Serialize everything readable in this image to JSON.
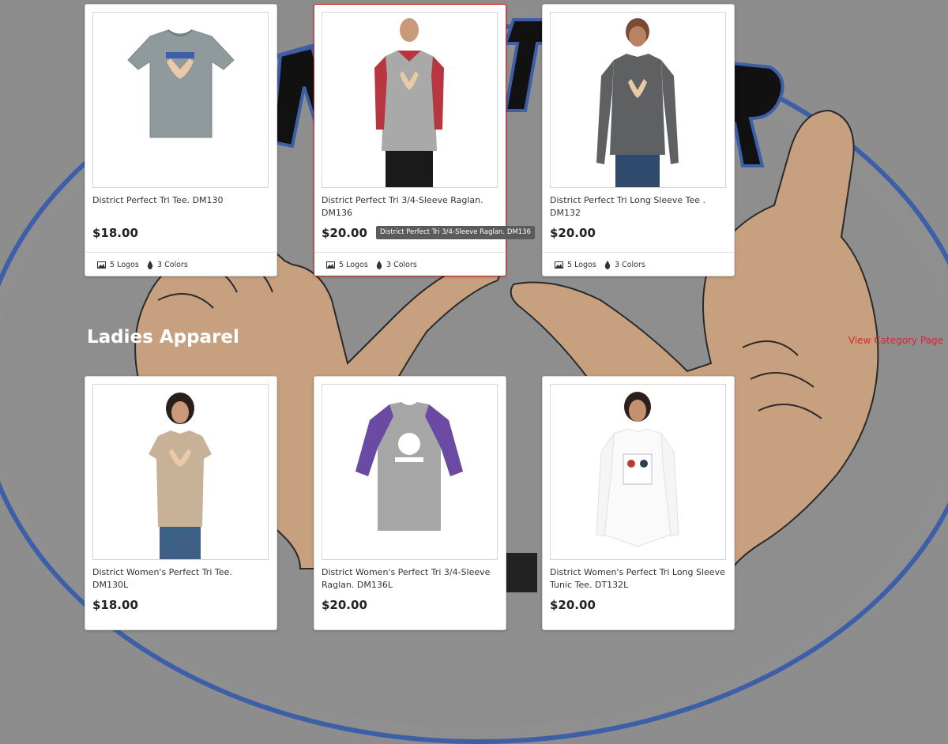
{
  "mens": {
    "products": [
      {
        "title": "District Perfect Tri Tee. DM130",
        "price": "$18.00",
        "logos": "5 Logos",
        "colors": "3 Colors"
      },
      {
        "title": "District Perfect Tri 3/4-Sleeve Raglan. DM136",
        "price": "$20.00",
        "logos": "5 Logos",
        "colors": "3 Colors"
      },
      {
        "title": "District Perfect Tri Long Sleeve Tee . DM132",
        "price": "$20.00",
        "logos": "5 Logos",
        "colors": "3 Colors"
      }
    ]
  },
  "tooltip": "District Perfect Tri 3/4-Sleeve Raglan. DM136",
  "ladies": {
    "heading": "Ladies Apparel",
    "category_link": "View Category Page",
    "products": [
      {
        "title": "District Women's Perfect Tri Tee. DM130L",
        "price": "$18.00"
      },
      {
        "title": "District Women's Perfect Tri 3/4-Sleeve Raglan. DM136L",
        "price": "$20.00"
      },
      {
        "title": "District Women's Perfect Tri Long Sleeve Tunic Tee. DT132L",
        "price": "$20.00"
      }
    ]
  },
  "colors": {
    "accent": "#d7262f",
    "background": "#8d8d8d",
    "brand_blue": "#3d5fa8"
  },
  "icons": {
    "logos": "image-icon",
    "colors": "droplet-icon"
  }
}
